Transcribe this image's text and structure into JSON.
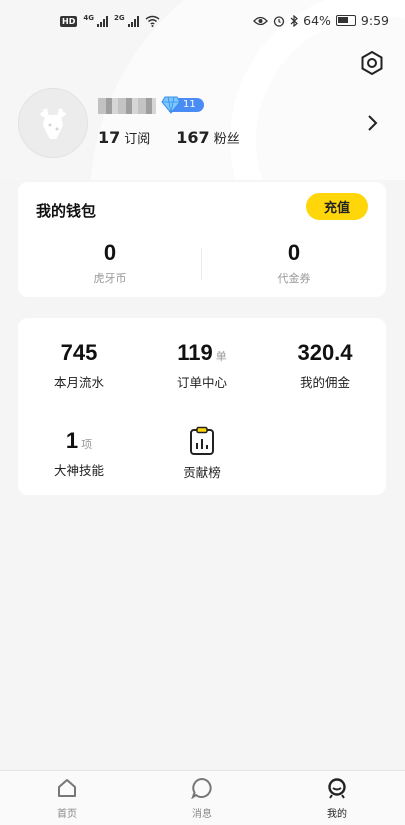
{
  "status_bar": {
    "hd": "HD",
    "net1": "4G",
    "net2": "2G",
    "battery_pct": "64%",
    "time": "9:59"
  },
  "profile": {
    "level": "11",
    "subscriptions_count": "17",
    "subscriptions_label": "订阅",
    "fans_count": "167",
    "fans_label": "粉丝"
  },
  "wallet": {
    "title": "我的钱包",
    "recharge_label": "充值",
    "huya_coin_value": "0",
    "huya_coin_label": "虎牙币",
    "voucher_value": "0",
    "voucher_label": "代金券"
  },
  "stats": {
    "monthly_flow_value": "745",
    "monthly_flow_label": "本月流水",
    "order_value": "119",
    "order_unit": "单",
    "order_label": "订单中心",
    "commission_value": "320.4",
    "commission_label": "我的佣金",
    "skills_value": "1",
    "skills_unit": "项",
    "skills_label": "大神技能",
    "contribution_label": "贡献榜"
  },
  "tabs": [
    {
      "label": "首页",
      "icon": "home-icon"
    },
    {
      "label": "消息",
      "icon": "message-icon"
    },
    {
      "label": "我的",
      "icon": "profile-icon"
    }
  ],
  "colors": {
    "accent": "#ffd60a",
    "level_badge": "#4a8cf5",
    "background": "#f5f5f5"
  }
}
